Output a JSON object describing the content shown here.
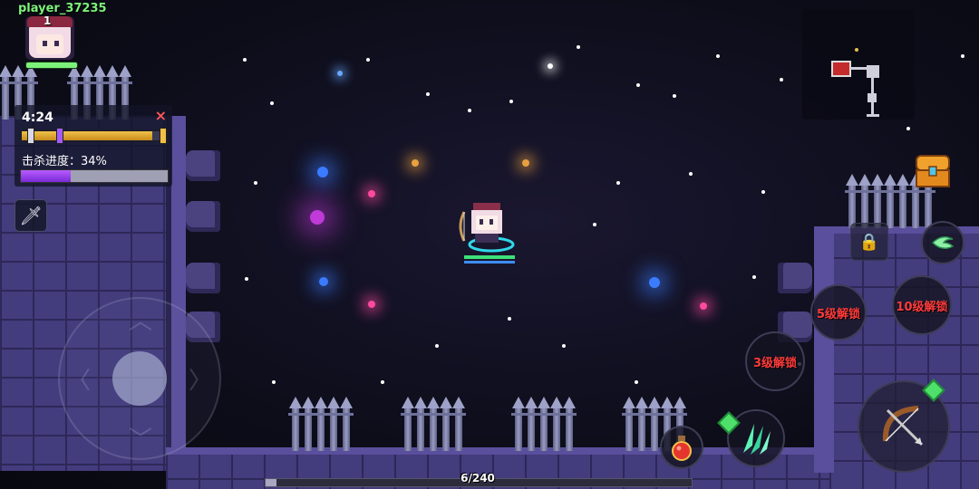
{
  "player": {
    "name": "player_37235",
    "level": "1"
  },
  "wave": {
    "timer": "4:24",
    "close_icon": "×",
    "progress": 0.9
  },
  "kill": {
    "label": "击杀进度：34%",
    "progress": 0.34
  },
  "weapon": {
    "icon": "sword-icon",
    "glyph": "🗡"
  },
  "skills": {
    "slot_a": "5级解锁",
    "slot_b": "10级解锁",
    "slot_c": "3级解锁"
  },
  "xp": {
    "text": "6/240",
    "current": 6,
    "max": 240
  },
  "colors": {
    "player_name": "#7df27a",
    "lock_text": "#ff3b3b",
    "kill_bar": "#9b45f0",
    "wave_bar": "#e3ad33"
  }
}
